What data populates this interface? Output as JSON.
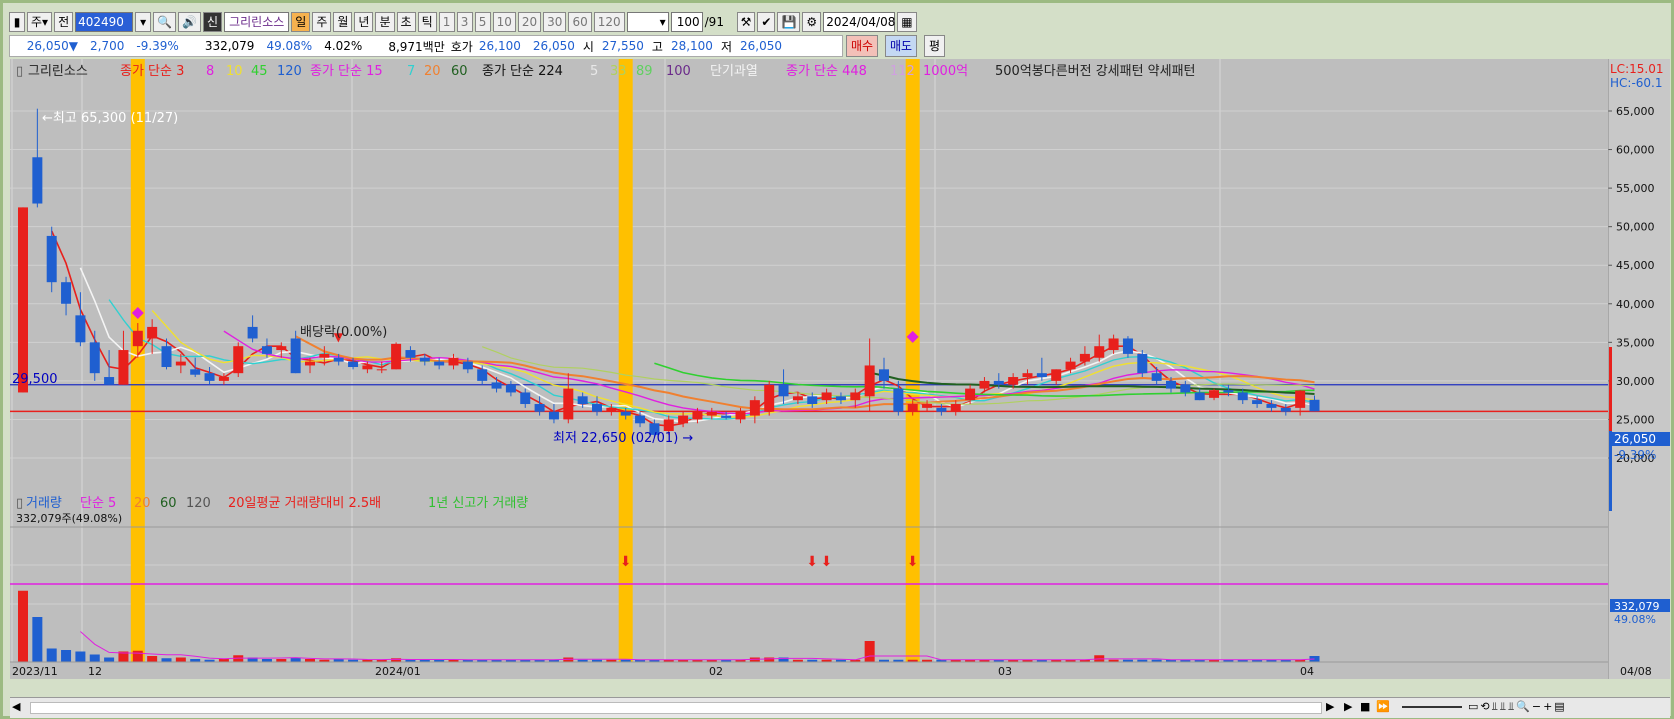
{
  "toolbar": {
    "mode": "주",
    "prev": "전",
    "code": "402490",
    "name": "그리린소스",
    "periods": [
      "일",
      "주",
      "월",
      "년",
      "분",
      "초",
      "틱"
    ],
    "numbers": [
      "1",
      "3",
      "5",
      "10",
      "20",
      "30",
      "60",
      "120"
    ],
    "count": "100",
    "total": "/91",
    "date": "2024/04/08"
  },
  "quote": {
    "price": "26,050▼",
    "change": "2,700",
    "pct": "-9.39%",
    "volume": "332,079",
    "vol_pct": "49.08%",
    "turnover": "4.02%",
    "amount": "8,971백만",
    "ask_label": "호가",
    "ask1": "26,100",
    "ask2": "26,050",
    "open_label": "시",
    "open": "27,550",
    "high_label": "고",
    "high": "28,100",
    "low_label": "저",
    "low": "26,050",
    "buy": "매수",
    "sell": "매도",
    "avg": "평"
  },
  "price_legend": {
    "name": "그리린소스",
    "ma1_label": "종가 단순 3",
    "ma1_nums": [
      "8",
      "10",
      "45",
      "120"
    ],
    "ma2_label": "종가 단순 15",
    "ma2_nums": [
      "7",
      "20",
      "60"
    ],
    "ma3_label": "종가 단순 224",
    "ma3_nums": [
      "5",
      "33",
      "89",
      "100"
    ],
    "overheat": "단기과열",
    "ma4_label": "종가 단순 448",
    "ma4_nums": [
      "112"
    ],
    "amount_1000": "1000억",
    "pattern": "500억봉다른버전 강세패턴  약세패턴"
  },
  "annotations": {
    "high": "최고 65,300 (11/27)",
    "low": "최저 22,650 (02/01)",
    "dividend": "배당락(0.00%)",
    "line_level": "29,500"
  },
  "right_scale": {
    "lc": "LC:15.01",
    "hc": "HC:-60.1",
    "ticks": [
      "65,000",
      "60,000",
      "55,000",
      "50,000",
      "45,000",
      "40,000",
      "35,000",
      "30,000",
      "25,000",
      "20,000"
    ],
    "current_price": "26,050",
    "current_pct": "-9.39%",
    "vol_value": "332,079",
    "vol_pct": "49.08%"
  },
  "volume_legend": {
    "label": "거래량",
    "ma_label": "단순 5",
    "ma_nums": [
      "20",
      "60",
      "120"
    ],
    "avg_ratio": "20일평균 거래량대비 2.5배",
    "new_high": "1년 신고가 거래량",
    "current": "332,079주(49.08%)"
  },
  "x_axis": {
    "labels": [
      "2023/11",
      "12",
      "2024/01",
      "02",
      "03",
      "04"
    ],
    "last": "04/08"
  },
  "colors": {
    "up": "#e8201c",
    "down": "#1f5fd0",
    "highlight": "#ffc000",
    "bg": "#bebebe"
  },
  "chart_data": {
    "type": "candlestick",
    "candles": [
      {
        "o": 28500,
        "h": 52500,
        "l": 28500,
        "c": 52500
      },
      {
        "o": 59000,
        "h": 65300,
        "l": 52500,
        "c": 53000
      },
      {
        "o": 48800,
        "h": 50000,
        "l": 41500,
        "c": 42800
      },
      {
        "o": 42800,
        "h": 43500,
        "l": 38500,
        "c": 40000
      },
      {
        "o": 38500,
        "h": 41500,
        "l": 34500,
        "c": 35000
      },
      {
        "o": 35000,
        "h": 36500,
        "l": 30000,
        "c": 31000
      },
      {
        "o": 30500,
        "h": 34000,
        "l": 29500,
        "c": 29500
      },
      {
        "o": 29500,
        "h": 36500,
        "l": 29500,
        "c": 34000
      },
      {
        "o": 34500,
        "h": 37500,
        "l": 33000,
        "c": 36500
      },
      {
        "o": 35500,
        "h": 38000,
        "l": 33500,
        "c": 37000
      },
      {
        "o": 34500,
        "h": 35500,
        "l": 31500,
        "c": 31800
      },
      {
        "o": 32000,
        "h": 33500,
        "l": 31000,
        "c": 32500
      },
      {
        "o": 31500,
        "h": 33000,
        "l": 30500,
        "c": 30800
      },
      {
        "o": 31000,
        "h": 31800,
        "l": 29500,
        "c": 30000
      },
      {
        "o": 30000,
        "h": 31000,
        "l": 29500,
        "c": 30500
      },
      {
        "o": 31000,
        "h": 35000,
        "l": 30500,
        "c": 34500
      },
      {
        "o": 37000,
        "h": 38500,
        "l": 35000,
        "c": 35500
      },
      {
        "o": 34500,
        "h": 35500,
        "l": 33000,
        "c": 33500
      },
      {
        "o": 34000,
        "h": 35000,
        "l": 33000,
        "c": 34500
      },
      {
        "o": 35500,
        "h": 36500,
        "l": 31000,
        "c": 31000
      },
      {
        "o": 32000,
        "h": 33000,
        "l": 31000,
        "c": 32500
      },
      {
        "o": 33000,
        "h": 34500,
        "l": 32000,
        "c": 33500
      },
      {
        "o": 33000,
        "h": 33500,
        "l": 32000,
        "c": 32500
      },
      {
        "o": 32500,
        "h": 33000,
        "l": 31500,
        "c": 31800
      },
      {
        "o": 31500,
        "h": 32500,
        "l": 31000,
        "c": 32000
      },
      {
        "o": 31500,
        "h": 32500,
        "l": 31000,
        "c": 31500
      },
      {
        "o": 31500,
        "h": 35000,
        "l": 31500,
        "c": 34800
      },
      {
        "o": 34000,
        "h": 34500,
        "l": 32500,
        "c": 33000
      },
      {
        "o": 33000,
        "h": 33500,
        "l": 32000,
        "c": 32500
      },
      {
        "o": 32500,
        "h": 33000,
        "l": 31500,
        "c": 32000
      },
      {
        "o": 32000,
        "h": 33500,
        "l": 31500,
        "c": 33000
      },
      {
        "o": 32500,
        "h": 33000,
        "l": 31000,
        "c": 31500
      },
      {
        "o": 31500,
        "h": 32000,
        "l": 29500,
        "c": 30000
      },
      {
        "o": 29800,
        "h": 30500,
        "l": 28500,
        "c": 29000
      },
      {
        "o": 29500,
        "h": 30000,
        "l": 28000,
        "c": 28500
      },
      {
        "o": 28500,
        "h": 29000,
        "l": 26500,
        "c": 27000
      },
      {
        "o": 27000,
        "h": 28000,
        "l": 25500,
        "c": 26000
      },
      {
        "o": 26000,
        "h": 27000,
        "l": 24500,
        "c": 25000
      },
      {
        "o": 25000,
        "h": 31000,
        "l": 24500,
        "c": 29000
      },
      {
        "o": 28000,
        "h": 28500,
        "l": 26500,
        "c": 27000
      },
      {
        "o": 27000,
        "h": 28000,
        "l": 25500,
        "c": 26000
      },
      {
        "o": 26000,
        "h": 27000,
        "l": 25500,
        "c": 26500
      },
      {
        "o": 26000,
        "h": 26500,
        "l": 25000,
        "c": 25500
      },
      {
        "o": 25500,
        "h": 26000,
        "l": 24000,
        "c": 24500
      },
      {
        "o": 24500,
        "h": 25000,
        "l": 22650,
        "c": 23000
      },
      {
        "o": 23500,
        "h": 25500,
        "l": 23000,
        "c": 25000
      },
      {
        "o": 24500,
        "h": 26000,
        "l": 24000,
        "c": 25500
      },
      {
        "o": 25000,
        "h": 26500,
        "l": 24500,
        "c": 26000
      },
      {
        "o": 25500,
        "h": 26500,
        "l": 25000,
        "c": 26000
      },
      {
        "o": 25500,
        "h": 26000,
        "l": 25000,
        "c": 25200
      },
      {
        "o": 25000,
        "h": 26500,
        "l": 24500,
        "c": 26000
      },
      {
        "o": 25500,
        "h": 28000,
        "l": 24500,
        "c": 27500
      },
      {
        "o": 26000,
        "h": 30000,
        "l": 25500,
        "c": 29500
      },
      {
        "o": 29500,
        "h": 31500,
        "l": 27000,
        "c": 28000
      },
      {
        "o": 27500,
        "h": 28500,
        "l": 27000,
        "c": 28000
      },
      {
        "o": 28000,
        "h": 28500,
        "l": 26500,
        "c": 27000
      },
      {
        "o": 27500,
        "h": 29000,
        "l": 27000,
        "c": 28500
      },
      {
        "o": 28000,
        "h": 28500,
        "l": 27000,
        "c": 27500
      },
      {
        "o": 27500,
        "h": 29000,
        "l": 26500,
        "c": 28500
      },
      {
        "o": 28000,
        "h": 35500,
        "l": 26000,
        "c": 32000
      },
      {
        "o": 31500,
        "h": 33000,
        "l": 29000,
        "c": 30000
      },
      {
        "o": 29000,
        "h": 30000,
        "l": 25500,
        "c": 26000
      },
      {
        "o": 26000,
        "h": 27500,
        "l": 25500,
        "c": 27000
      },
      {
        "o": 26500,
        "h": 27500,
        "l": 26000,
        "c": 27000
      },
      {
        "o": 26500,
        "h": 27000,
        "l": 25500,
        "c": 26000
      },
      {
        "o": 26000,
        "h": 27500,
        "l": 25500,
        "c": 27000
      },
      {
        "o": 27500,
        "h": 29500,
        "l": 27000,
        "c": 29000
      },
      {
        "o": 29000,
        "h": 30500,
        "l": 28500,
        "c": 30000
      },
      {
        "o": 30000,
        "h": 31000,
        "l": 29000,
        "c": 29500
      },
      {
        "o": 29500,
        "h": 31000,
        "l": 29000,
        "c": 30500
      },
      {
        "o": 30500,
        "h": 31500,
        "l": 29500,
        "c": 31000
      },
      {
        "o": 31000,
        "h": 33000,
        "l": 30000,
        "c": 30500
      },
      {
        "o": 30000,
        "h": 31500,
        "l": 29500,
        "c": 31500
      },
      {
        "o": 31500,
        "h": 33000,
        "l": 31000,
        "c": 32500
      },
      {
        "o": 32500,
        "h": 34500,
        "l": 32000,
        "c": 33500
      },
      {
        "o": 33000,
        "h": 36000,
        "l": 32500,
        "c": 34500
      },
      {
        "o": 34000,
        "h": 36000,
        "l": 33500,
        "c": 35500
      },
      {
        "o": 35500,
        "h": 35800,
        "l": 33000,
        "c": 33500
      },
      {
        "o": 33500,
        "h": 34000,
        "l": 30500,
        "c": 31000
      },
      {
        "o": 31000,
        "h": 31800,
        "l": 29500,
        "c": 30000
      },
      {
        "o": 30000,
        "h": 30500,
        "l": 28500,
        "c": 29000
      },
      {
        "o": 29500,
        "h": 30000,
        "l": 28000,
        "c": 28500
      },
      {
        "o": 28500,
        "h": 29000,
        "l": 27500,
        "c": 27500
      },
      {
        "o": 27800,
        "h": 29000,
        "l": 27500,
        "c": 28800
      },
      {
        "o": 28800,
        "h": 29500,
        "l": 28000,
        "c": 28500
      },
      {
        "o": 28500,
        "h": 29000,
        "l": 27000,
        "c": 27500
      },
      {
        "o": 27500,
        "h": 28000,
        "l": 26500,
        "c": 27000
      },
      {
        "o": 27000,
        "h": 27500,
        "l": 26000,
        "c": 26500
      },
      {
        "o": 26500,
        "h": 27000,
        "l": 25500,
        "c": 26000
      },
      {
        "o": 26500,
        "h": 28800,
        "l": 25500,
        "c": 28750
      },
      {
        "o": 27550,
        "h": 28100,
        "l": 26050,
        "c": 26050
      }
    ],
    "volume_scale": 100,
    "volumes": [
      95,
      60,
      18,
      16,
      14,
      10,
      6,
      14,
      15,
      8,
      5,
      6,
      4,
      3,
      4,
      9,
      6,
      4,
      4,
      6,
      4,
      3,
      4,
      3,
      3,
      3,
      5,
      3,
      3,
      3,
      3,
      3,
      3,
      3,
      3,
      3,
      3,
      3,
      6,
      3,
      3,
      3,
      3,
      3,
      3,
      3,
      3,
      3,
      3,
      3,
      3,
      6,
      6,
      6,
      3,
      3,
      3,
      3,
      3,
      28,
      3,
      3,
      3,
      3,
      3,
      3,
      3,
      3,
      3,
      3,
      3,
      3,
      3,
      3,
      3,
      9,
      3,
      3,
      3,
      3,
      3,
      3,
      3,
      3,
      3,
      3,
      3,
      3,
      3,
      3,
      8
    ],
    "ylim": [
      20000,
      65300
    ],
    "highlight_candles": [
      8,
      42,
      62
    ],
    "horizontal_lines": [
      29500,
      26050
    ]
  }
}
